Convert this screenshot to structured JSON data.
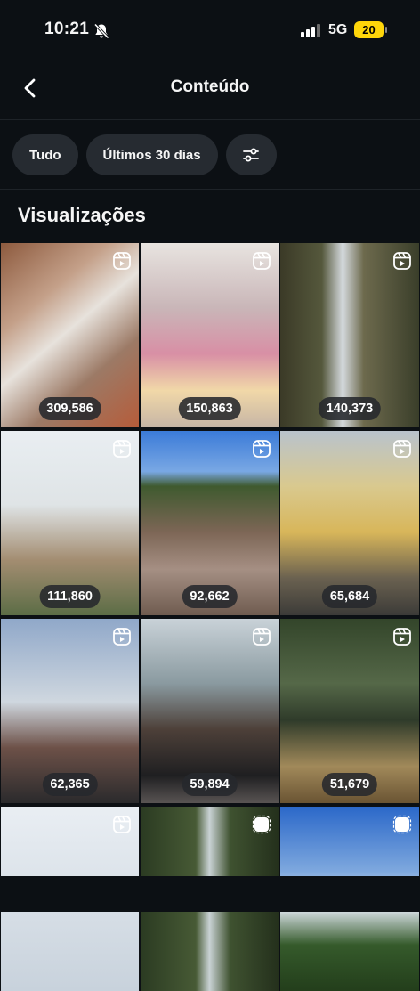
{
  "status": {
    "time": "10:21",
    "network": "5G",
    "battery": "20"
  },
  "header": {
    "title": "Conteúdo"
  },
  "filters": {
    "all_label": "Tudo",
    "range_label": "Últimos 30 dias"
  },
  "section": {
    "title": "Visualizações"
  },
  "grid": [
    {
      "views": "309,586",
      "type": "reel"
    },
    {
      "views": "150,863",
      "type": "reel"
    },
    {
      "views": "140,373",
      "type": "reel"
    },
    {
      "views": "111,860",
      "type": "reel"
    },
    {
      "views": "92,662",
      "type": "reel"
    },
    {
      "views": "65,684",
      "type": "reel"
    },
    {
      "views": "62,365",
      "type": "reel"
    },
    {
      "views": "59,894",
      "type": "reel"
    },
    {
      "views": "51,679",
      "type": "reel"
    },
    {
      "views": "",
      "type": "reel"
    },
    {
      "views": "",
      "type": "story"
    },
    {
      "views": "",
      "type": "story"
    }
  ],
  "icons": {
    "back": "chevron-left-icon",
    "silent": "bell-slash-icon",
    "filter": "sliders-icon",
    "reel": "reel-icon",
    "story": "story-icon"
  }
}
